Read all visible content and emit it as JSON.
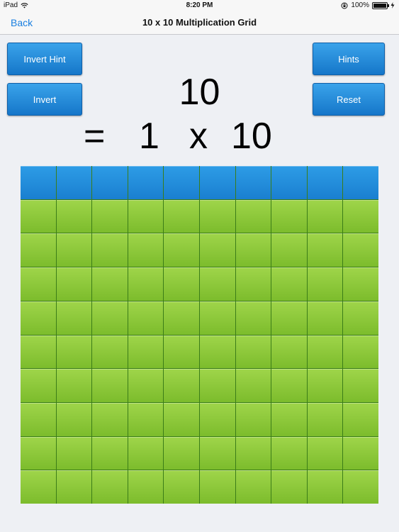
{
  "status_bar": {
    "device": "iPad",
    "time": "8:20 PM",
    "battery": "100%"
  },
  "nav": {
    "back_label": "Back",
    "title": "10 x 10 Multiplication Grid"
  },
  "buttons": {
    "invert_hint": "Invert Hint",
    "invert": "Invert",
    "hints": "Hints",
    "reset": "Reset"
  },
  "display": {
    "product": "10",
    "equals": "=",
    "factor_a": "1",
    "times": "x",
    "factor_b": "10"
  },
  "grid": {
    "rows": 10,
    "cols": 10,
    "highlighted_rows": 1,
    "highlighted_cols": 10
  },
  "colors": {
    "highlight": "#1a8ae0",
    "cell": "#8ccc3c",
    "button": "#1e86d6",
    "link": "#1a7fe0"
  },
  "icons": [
    "wifi-icon",
    "orientation-lock-icon",
    "battery-icon",
    "charging-icon"
  ]
}
